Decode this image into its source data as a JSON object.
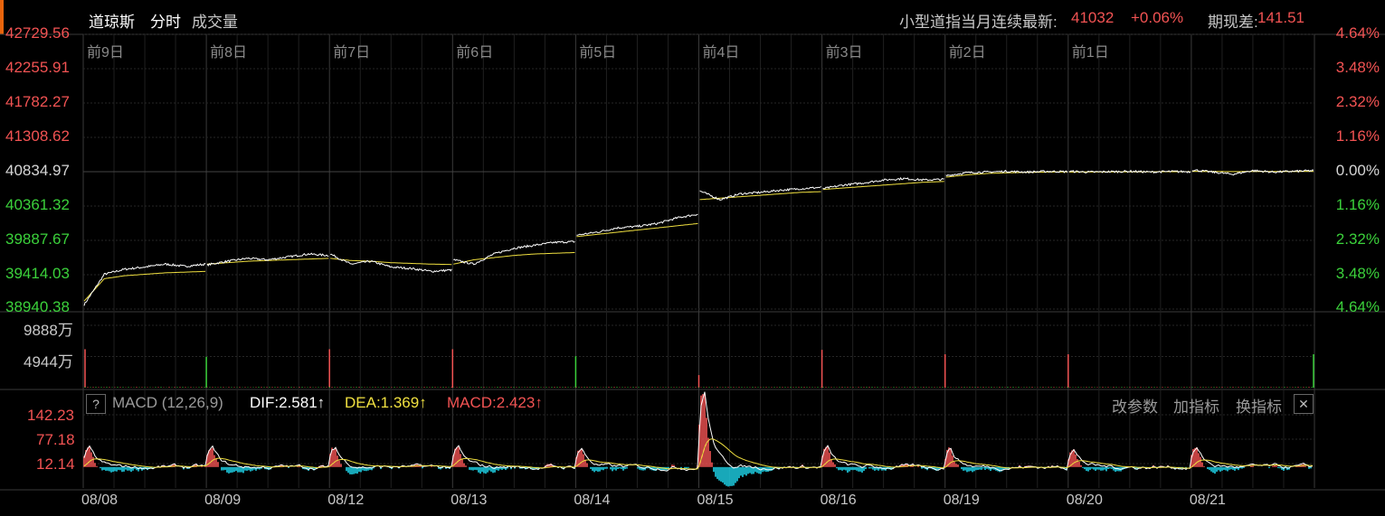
{
  "header": {
    "title": "道琼斯",
    "tab_intraday": "分时",
    "tab_volume": "成交量",
    "contract_label": "小型道指当月连续最新:",
    "latest_price": "41032",
    "change_pct": "+0.06%",
    "basis_label": "期现差:",
    "basis_value": "141.51"
  },
  "colors": {
    "up": "#f25353",
    "down": "#3bd13b",
    "neutral": "#d6d6d6",
    "price_line": "#ffffff",
    "avg_line": "#f0e040",
    "dif_line": "#ffffff",
    "dea_line": "#f0e040",
    "macd_pos": "#f25353",
    "macd_neg": "#1fd3e8",
    "grid": "#2a2a2a",
    "accent": "#e8640c"
  },
  "price_axis_left": [
    {
      "label": "42729.56",
      "tone": "up"
    },
    {
      "label": "42255.91",
      "tone": "up"
    },
    {
      "label": "41782.27",
      "tone": "up"
    },
    {
      "label": "41308.62",
      "tone": "up"
    },
    {
      "label": "40834.97",
      "tone": "neutral"
    },
    {
      "label": "40361.32",
      "tone": "down"
    },
    {
      "label": "39887.67",
      "tone": "down"
    },
    {
      "label": "39414.03",
      "tone": "down"
    },
    {
      "label": "38940.38",
      "tone": "down"
    }
  ],
  "price_axis_right": [
    {
      "label": "4.64%",
      "tone": "up"
    },
    {
      "label": "3.48%",
      "tone": "up"
    },
    {
      "label": "2.32%",
      "tone": "up"
    },
    {
      "label": "1.16%",
      "tone": "up"
    },
    {
      "label": "0.00%",
      "tone": "neutral"
    },
    {
      "label": "1.16%",
      "tone": "down"
    },
    {
      "label": "2.32%",
      "tone": "down"
    },
    {
      "label": "3.48%",
      "tone": "down"
    },
    {
      "label": "4.64%",
      "tone": "down"
    }
  ],
  "day_labels": [
    "前9日",
    "前8日",
    "前7日",
    "前6日",
    "前5日",
    "前4日",
    "前3日",
    "前2日",
    "前1日"
  ],
  "volume_axis": [
    "9888万",
    "4944万"
  ],
  "macd": {
    "name": "MACD (12,26,9)",
    "dif": "DIF:2.581↑",
    "dea": "DEA:1.369↑",
    "macd": "MACD:2.423↑",
    "help": "?",
    "btn_params": "改参数",
    "btn_add": "加指标",
    "btn_switch": "换指标",
    "btn_close": "✕",
    "axis": [
      "142.23",
      "77.18",
      "12.14"
    ]
  },
  "dates": [
    "08/08",
    "08/09",
    "08/12",
    "08/13",
    "08/14",
    "08/15",
    "08/16",
    "08/19",
    "08/20",
    "08/21"
  ],
  "chart_data": {
    "type": "line",
    "title": "道琼斯",
    "ylim": [
      38940.38,
      42729.56
    ],
    "prev_close": 40834.97,
    "categories": [
      "08/08",
      "08/09",
      "08/12",
      "08/13",
      "08/14",
      "08/15",
      "08/16",
      "08/19",
      "08/20",
      "08/21"
    ],
    "series": [
      {
        "name": "price",
        "day_points": [
          [
            39000,
            39420,
            39490,
            39520,
            39560,
            39530,
            39560
          ],
          [
            39550,
            39600,
            39640,
            39620,
            39660,
            39700,
            39680
          ],
          [
            39700,
            39560,
            39600,
            39520,
            39500,
            39460,
            39480
          ],
          [
            39620,
            39560,
            39700,
            39780,
            39820,
            39860,
            39870
          ],
          [
            39960,
            40000,
            40060,
            40080,
            40120,
            40200,
            40250
          ],
          [
            40570,
            40450,
            40530,
            40550,
            40580,
            40600,
            40620
          ],
          [
            40600,
            40650,
            40680,
            40720,
            40740,
            40720,
            40730
          ],
          [
            40780,
            40820,
            40830,
            40840,
            40830,
            40840,
            40835
          ],
          [
            40840,
            40830,
            40835,
            40840,
            40830,
            40838,
            40835
          ],
          [
            40860,
            40830,
            40800,
            40850,
            40830,
            40840,
            40850
          ]
        ]
      },
      {
        "name": "average",
        "day_points": [
          [
            39050,
            39360,
            39400,
            39420,
            39440,
            39450,
            39460
          ],
          [
            39560,
            39580,
            39600,
            39610,
            39620,
            39630,
            39640
          ],
          [
            39640,
            39610,
            39600,
            39580,
            39570,
            39560,
            39555
          ],
          [
            39560,
            39620,
            39650,
            39680,
            39700,
            39710,
            39720
          ],
          [
            39940,
            39970,
            40000,
            40030,
            40060,
            40090,
            40120
          ],
          [
            40450,
            40470,
            40490,
            40510,
            40530,
            40550,
            40560
          ],
          [
            40590,
            40610,
            40630,
            40650,
            40670,
            40690,
            40700
          ],
          [
            40760,
            40790,
            40810,
            40820,
            40825,
            40830,
            40832
          ],
          [
            40830,
            40832,
            40833,
            40834,
            40834,
            40835,
            40835
          ],
          [
            40840,
            40838,
            40836,
            40838,
            40838,
            40839,
            40840
          ]
        ]
      }
    ],
    "volume": {
      "ylim": [
        0,
        9888
      ],
      "unit": "万",
      "open_spikes": [
        {
          "value": 6100,
          "tone": "up"
        },
        {
          "value": 4900,
          "tone": "down"
        },
        {
          "value": 6100,
          "tone": "up"
        },
        {
          "value": 6100,
          "tone": "up"
        },
        {
          "value": 5000,
          "tone": "down"
        },
        {
          "value": 2000,
          "tone": "up"
        },
        {
          "value": 6000,
          "tone": "up"
        },
        {
          "value": 5300,
          "tone": "up"
        },
        {
          "value": 5300,
          "tone": "up"
        },
        {
          "value": 5300,
          "tone": "down"
        }
      ],
      "base_level": 150
    },
    "macd": {
      "ylim": [
        -40,
        142.23
      ],
      "ticks": [
        142.23,
        77.18,
        12.14
      ],
      "dif": 2.581,
      "dea": 1.369,
      "hist": 2.423
    }
  }
}
